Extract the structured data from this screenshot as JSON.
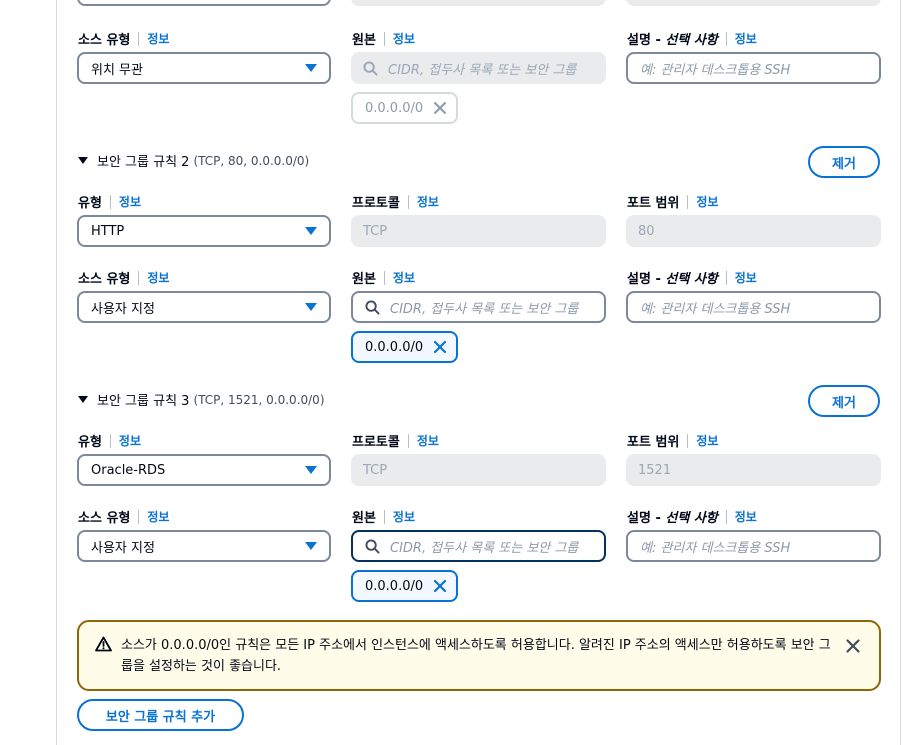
{
  "labels": {
    "info": "정보",
    "source_type": "소스 유형",
    "source": "원본",
    "description": "설명 -",
    "optional": "선택 사항",
    "type": "유형",
    "protocol": "프로토콜",
    "port_range": "포트 범위"
  },
  "placeholders": {
    "cidr_search": "CIDR, 접두사 목록 또는 보안 그룹",
    "description": "예: 관리자 데스크톱용 SSH"
  },
  "rule1": {
    "source_type_value": "위치 무관",
    "token": "0.0.0.0/0",
    "token_disabled": true
  },
  "rule2": {
    "header_title": "보안 그룹 규칙 2",
    "header_detail": "(TCP, 80, 0.0.0.0/0)",
    "remove_label": "제거",
    "type_value": "HTTP",
    "protocol_value": "TCP",
    "port_value": "80",
    "source_type_value": "사용자 지정",
    "token": "0.0.0.0/0"
  },
  "rule3": {
    "header_title": "보안 그룹 규칙 3",
    "header_detail": "(TCP, 1521, 0.0.0.0/0)",
    "remove_label": "제거",
    "type_value": "Oracle-RDS",
    "protocol_value": "TCP",
    "port_value": "1521",
    "source_type_value": "사용자 지정",
    "token": "0.0.0.0/0"
  },
  "alert": {
    "text": "소스가 0.0.0.0/0인 규칙은 모든 IP 주소에서 인스턴스에 액세스하도록 허용합니다. 알려진 IP 주소의 액세스만 허용하도록 보안 그룹을 설정하는 것이 좋습니다.",
    "icon": "warning-icon",
    "color": "#8d6605"
  },
  "add_rule_label": "보안 그룹 규칙 추가",
  "colors": {
    "accent": "#0972d3",
    "border": "#7d8998",
    "disabled_bg": "#e9ebed",
    "warning_bg": "#fffce9"
  }
}
